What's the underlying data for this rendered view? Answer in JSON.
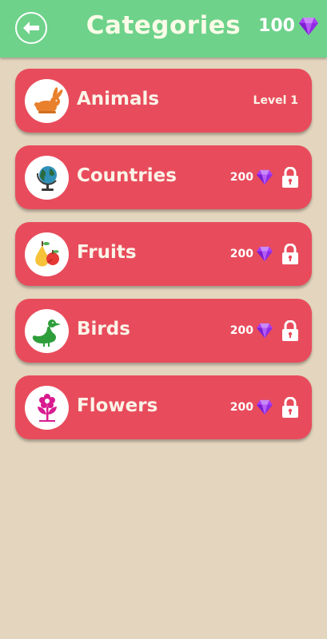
{
  "header": {
    "title": "Categories",
    "gem_count": "100",
    "back_icon": "arrow-left-icon",
    "gem_icon": "purple-gem-icon"
  },
  "categories": [
    {
      "label": "Animals",
      "icon": "rabbit-icon",
      "status": "Level 1",
      "locked": false
    },
    {
      "label": "Countries",
      "icon": "globe-icon",
      "price": "200",
      "locked": true
    },
    {
      "label": "Fruits",
      "icon": "fruits-icon",
      "price": "200",
      "locked": true
    },
    {
      "label": "Birds",
      "icon": "duck-icon",
      "price": "200",
      "locked": true
    },
    {
      "label": "Flowers",
      "icon": "flower-icon",
      "price": "200",
      "locked": true
    }
  ],
  "colors": {
    "background": "#e4d5be",
    "header": "#6ed28a",
    "card": "#e84c5c",
    "gem": "#9b3cf0"
  }
}
